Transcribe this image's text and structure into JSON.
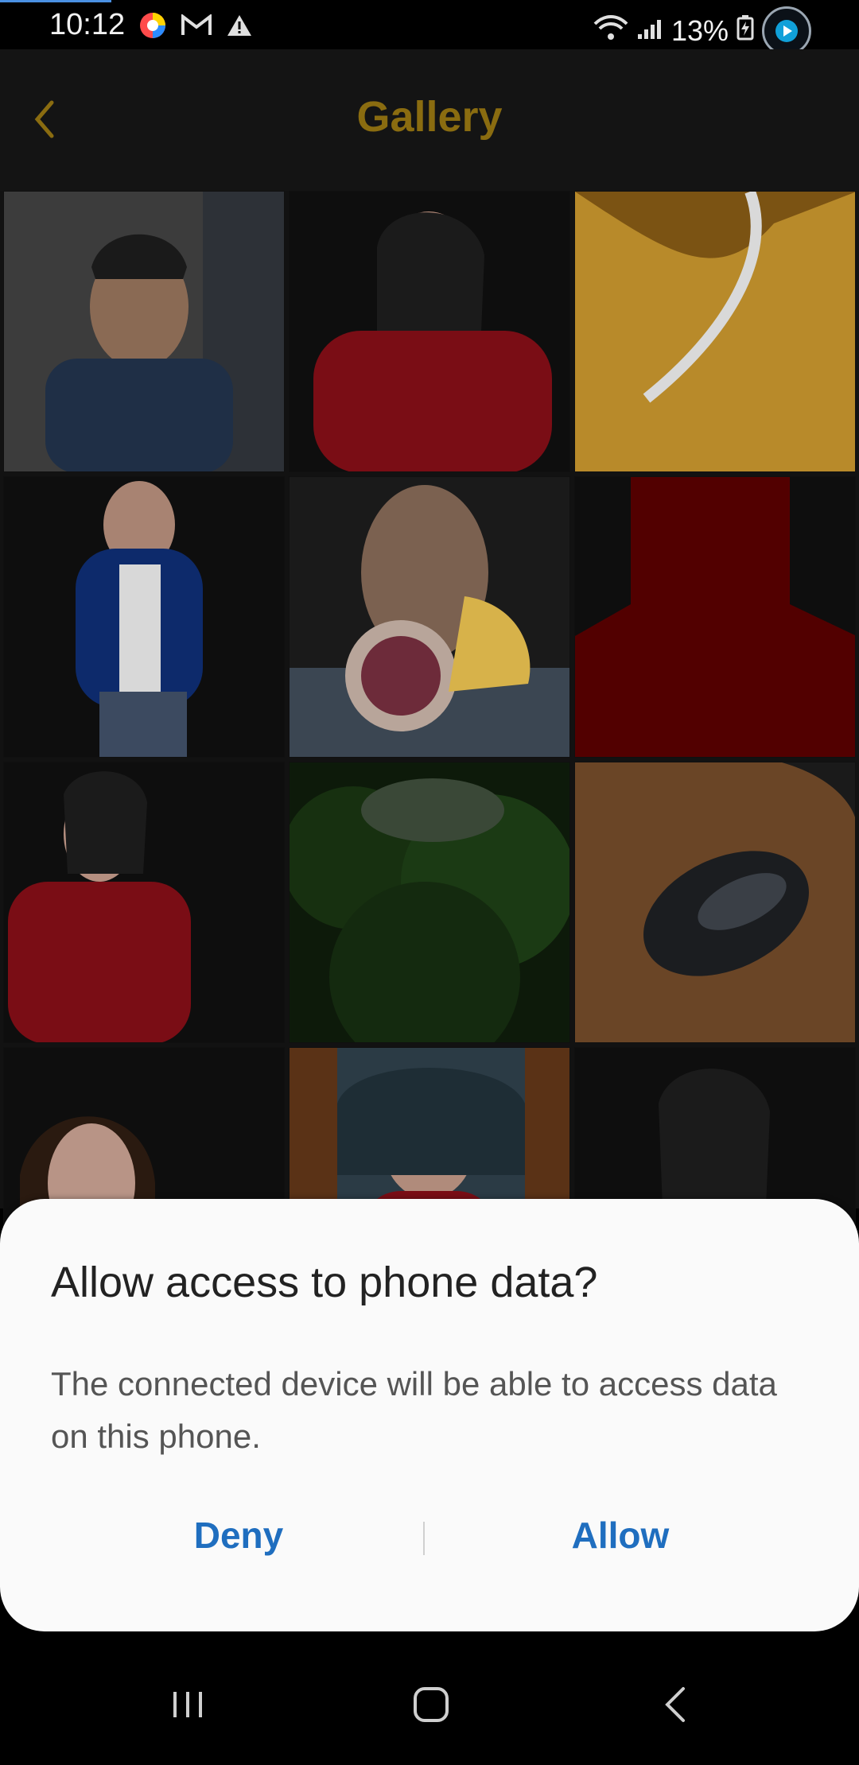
{
  "status_bar": {
    "time": "10:12",
    "battery": "13%",
    "icons": [
      "chrome-like-icon",
      "gmail-icon",
      "warning-icon",
      "wifi-icon",
      "signal-icon",
      "battery-charging-icon",
      "floating-overlay-icon"
    ]
  },
  "header": {
    "title": "Gallery",
    "back_icon": "chevron-left-icon"
  },
  "gallery": {
    "tiles": [
      "photo-portrait-young-man",
      "photo-woman-red-top",
      "photo-abstract-gold-glass",
      "photo-woman-blue-jacket",
      "photo-man-with-stickers",
      "photo-red-silhouette",
      "photo-woman-red-top-2",
      "photo-forest",
      "photo-computer-mouse",
      "photo-woman-closeup",
      "photo-woman-leaves-background",
      "photo-woman-red-top-3"
    ]
  },
  "dialog": {
    "title": "Allow access to phone data?",
    "message": "The connected device will be able to access data on this phone.",
    "deny": "Deny",
    "allow": "Allow"
  },
  "colors": {
    "accent": "#1f6ebf",
    "title_gold": "#8a6c10"
  }
}
